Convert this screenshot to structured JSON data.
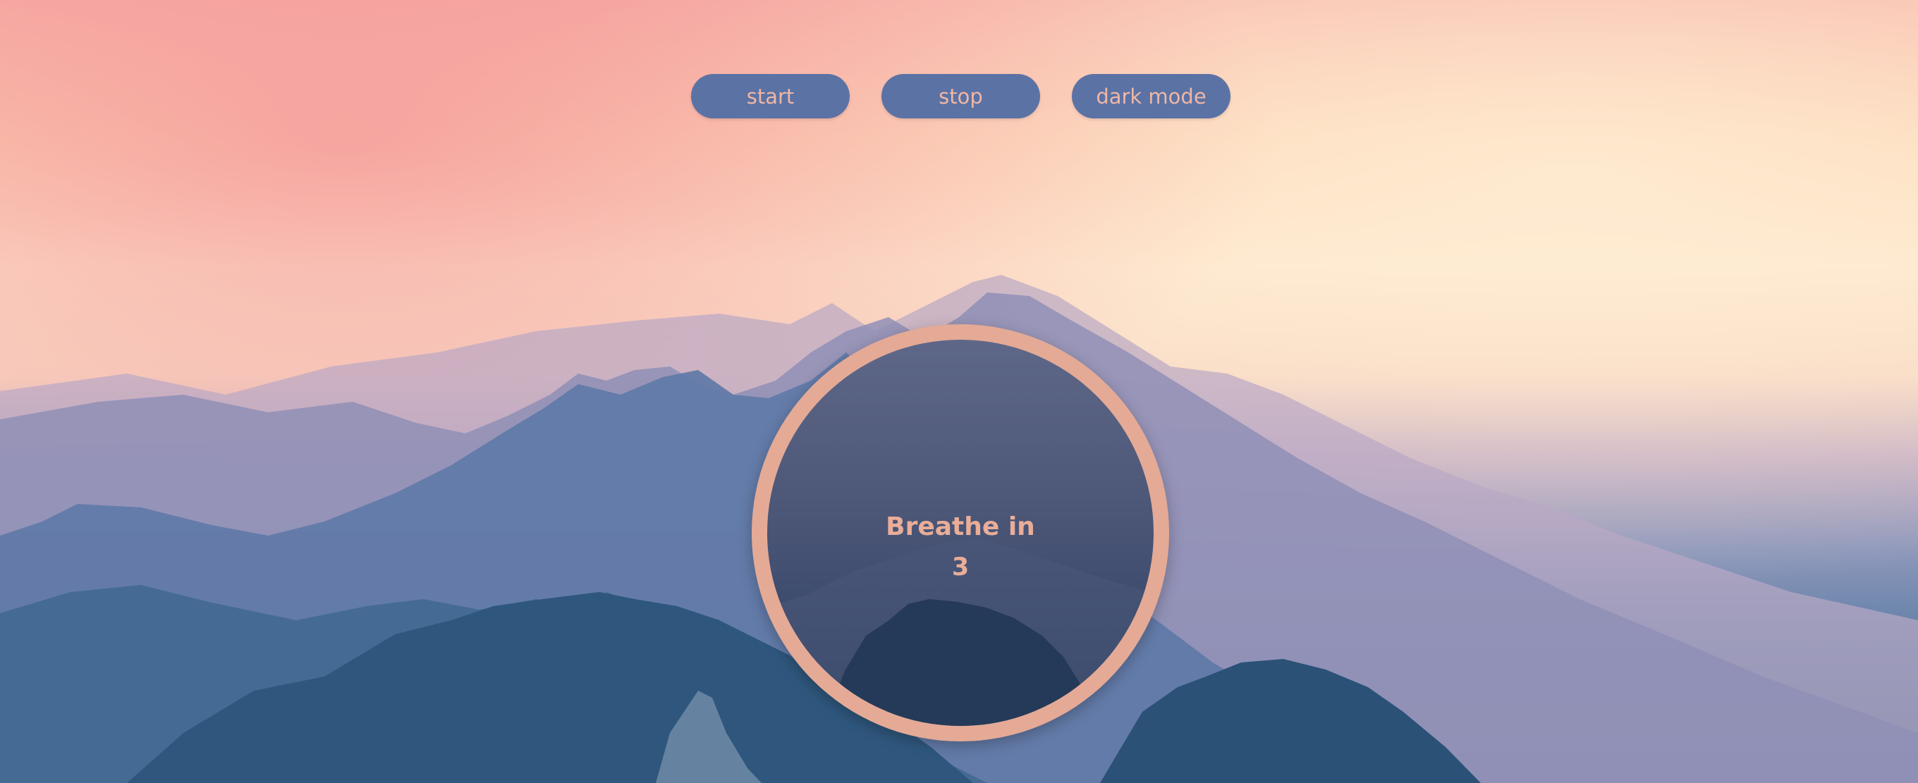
{
  "controls": {
    "start_label": "start",
    "stop_label": "stop",
    "dark_mode_label": "dark mode"
  },
  "breathing": {
    "phase": "Breathe in",
    "count": "3"
  },
  "colors": {
    "button_background": "#5b72a5",
    "accent_text": "#e9ad98",
    "ring": "#e4aa96"
  }
}
